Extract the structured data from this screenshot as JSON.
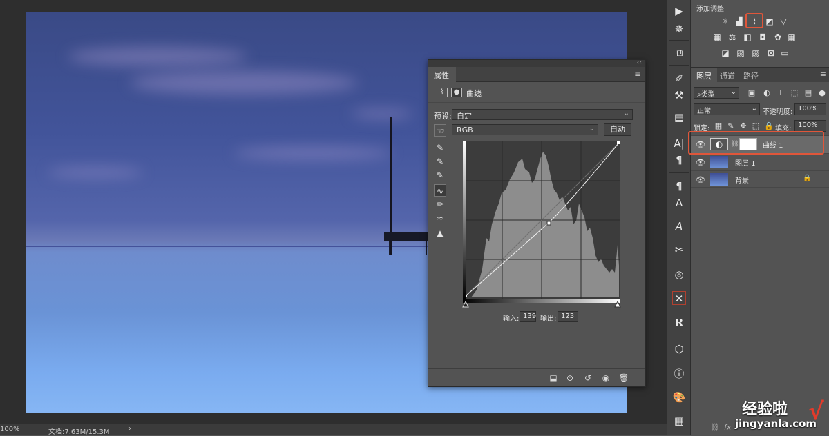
{
  "status": {
    "zoom": "100%",
    "doc": "文档:7.63M/15.3M",
    "arrow": "›"
  },
  "properties": {
    "tab": "属性",
    "menu_icon": "menu-icon",
    "panel_title": "曲线",
    "preset_label": "预设:",
    "preset_value": "自定",
    "channel_value": "RGB",
    "auto_label": "自动",
    "input_label": "输入:",
    "input_value": "139",
    "output_label": "输出:",
    "output_value": "123",
    "collapse": "‹‹"
  },
  "adjustments": {
    "title": "添加调整"
  },
  "layers": {
    "tabs": [
      "图层",
      "通道",
      "路径"
    ],
    "filter_kind": "类型",
    "blend_mode": "正常",
    "opacity_label": "不透明度:",
    "opacity_value": "100%",
    "lock_label": "锁定:",
    "fill_label": "填充:",
    "fill_value": "100%",
    "items": [
      {
        "name": "曲线 1",
        "kind": "curves-adjustment",
        "selected": true
      },
      {
        "name": "图层 1",
        "kind": "pixel"
      },
      {
        "name": "背景",
        "kind": "background",
        "locked": true
      }
    ]
  },
  "watermark": {
    "cn": "经验啦",
    "en": "jingyanla.com",
    "check": "√"
  },
  "colors": {
    "highlight": "#e0563a",
    "panel_bg": "#535353",
    "dark_bg": "#2e2e2e"
  }
}
